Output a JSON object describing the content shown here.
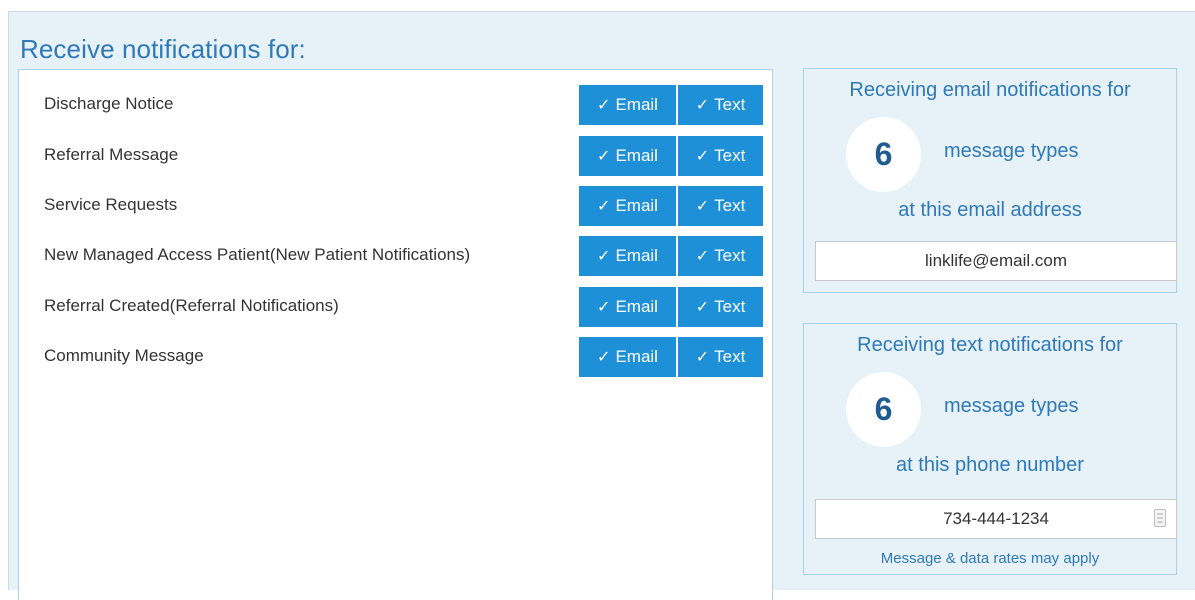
{
  "heading": "Receive notifications for:",
  "notification_rows": [
    {
      "label": "Discharge Notice",
      "email_label": "Email",
      "text_label": "Text",
      "email_checked": true,
      "text_checked": true
    },
    {
      "label": "Referral Message",
      "email_label": "Email",
      "text_label": "Text",
      "email_checked": true,
      "text_checked": true
    },
    {
      "label": "Service Requests",
      "email_label": "Email",
      "text_label": "Text",
      "email_checked": true,
      "text_checked": true
    },
    {
      "label": "New Managed Access Patient(New Patient Notifications)",
      "email_label": "Email",
      "text_label": "Text",
      "email_checked": true,
      "text_checked": true
    },
    {
      "label": "Referral Created(Referral Notifications)",
      "email_label": "Email",
      "text_label": "Text",
      "email_checked": true,
      "text_checked": true
    },
    {
      "label": "Community Message",
      "email_label": "Email",
      "text_label": "Text",
      "email_checked": true,
      "text_checked": true
    }
  ],
  "icons": {
    "check": "checkmark-icon",
    "phone_field": "contact-card-icon"
  },
  "email_summary": {
    "title": "Receiving email notifications for",
    "count": "6",
    "count_label": "message types",
    "subtitle": "at this email address",
    "email_value": "linklife@email.com"
  },
  "text_summary": {
    "title": "Receiving text notifications for",
    "count": "6",
    "count_label": "message types",
    "subtitle": "at this phone number",
    "phone_value": "734-444-1234",
    "disclaimer": "Message & data rates may apply"
  },
  "colors": {
    "accent": "#1e90d8",
    "heading": "#2f79b8",
    "panel_bg": "#e6f1f8",
    "border": "#a9d1ea"
  }
}
